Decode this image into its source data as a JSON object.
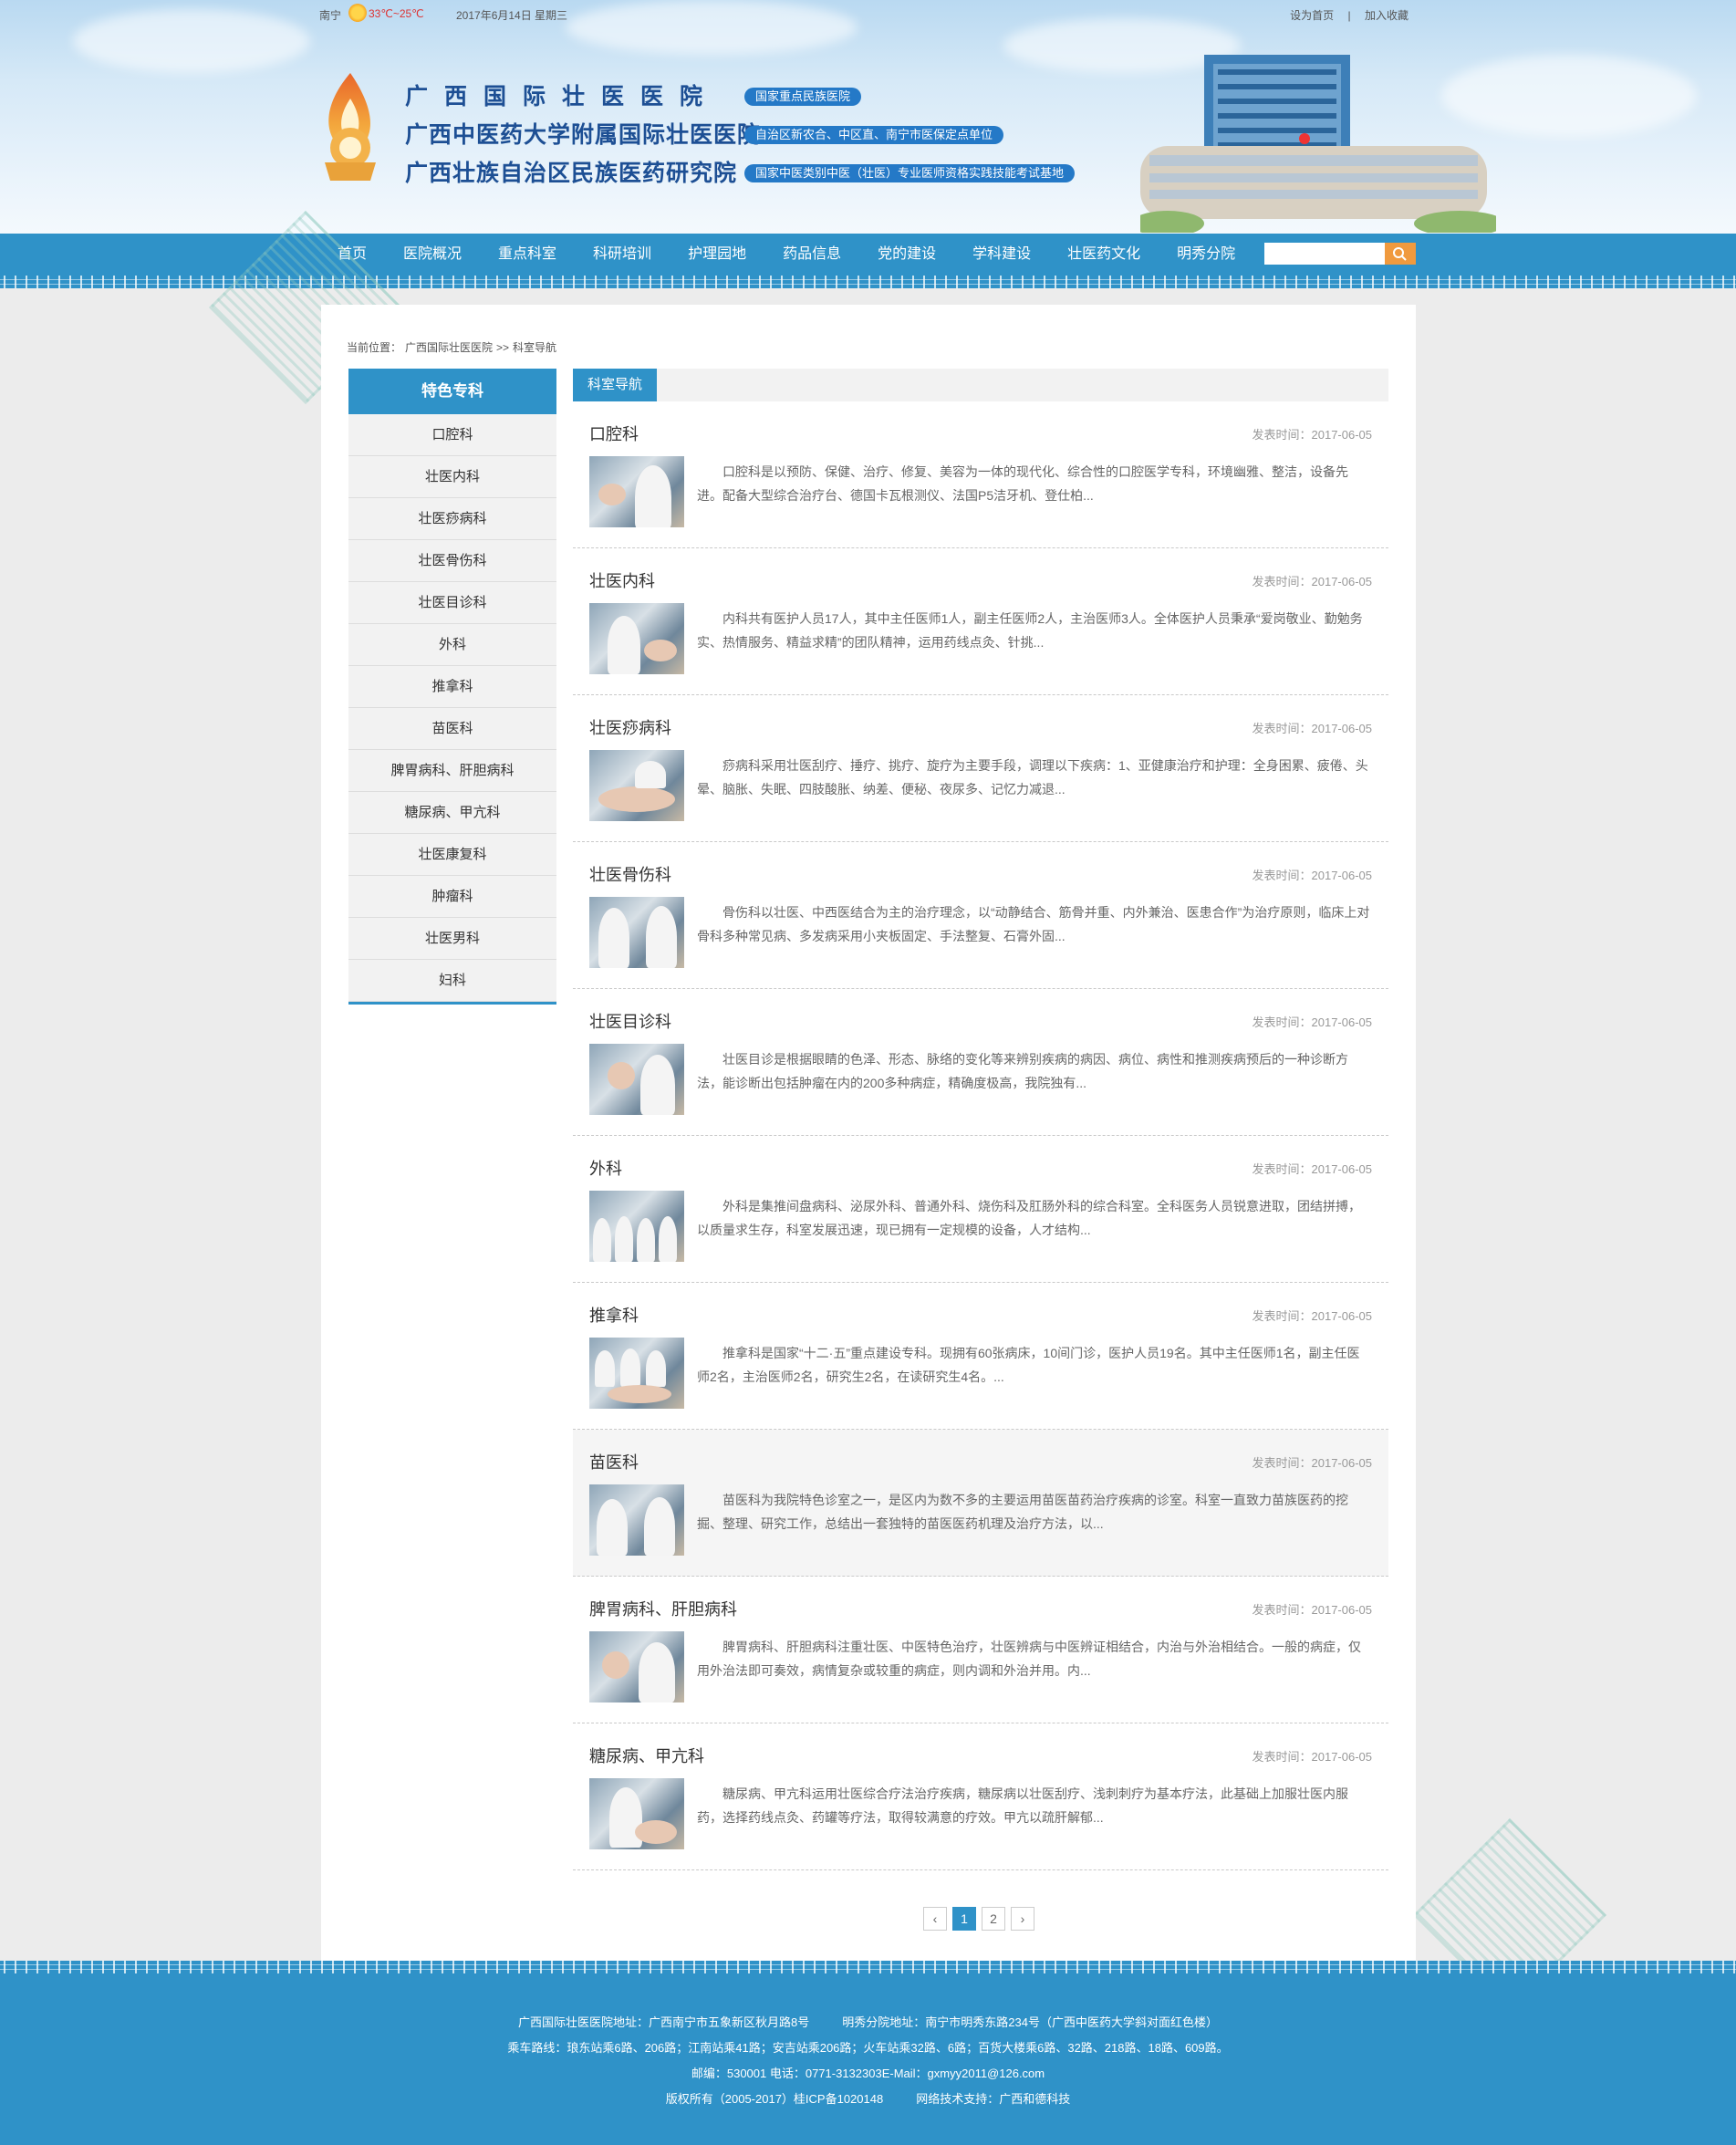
{
  "topbar": {
    "city": "南宁",
    "temperature": "33℃~25℃",
    "date": "2017年6月14日 星期三",
    "set_home": "设为首页",
    "separator": "|",
    "add_favorite": "加入收藏",
    "weather_icon": "sunny-cloudy-icon"
  },
  "header": {
    "names": [
      {
        "name": "广西国际壮医医院",
        "tag": "国家重点民族医院"
      },
      {
        "name": "广西中医药大学附属国际壮医医院",
        "tag": "自治区新农合、中区直、南宁市医保定点单位"
      },
      {
        "name": "广西壮族自治区民族医药研究院",
        "tag": "国家中医类别中医（壮医）专业医师资格实践技能考试基地"
      }
    ]
  },
  "nav": {
    "items": [
      "首页",
      "医院概况",
      "重点科室",
      "科研培训",
      "护理园地",
      "药品信息",
      "党的建设",
      "学科建设",
      "壮医药文化",
      "明秀分院"
    ],
    "search_placeholder": ""
  },
  "breadcrumb": {
    "label": "当前位置：",
    "home": "广西国际壮医医院",
    "sep": ">>",
    "current": "科室导航"
  },
  "sidebar": {
    "title": "特色专科",
    "items": [
      "口腔科",
      "壮医内科",
      "壮医痧病科",
      "壮医骨伤科",
      "壮医目诊科",
      "外科",
      "推拿科",
      "苗医科",
      "脾胃病科、肝胆病科",
      "糖尿病、甲亢科",
      "壮医康复科",
      "肿瘤科",
      "壮医男科",
      "妇科"
    ]
  },
  "content": {
    "section_title": "科室导航",
    "date_label": "发表时间：",
    "entries": [
      {
        "title": "口腔科",
        "date": "2017-06-05",
        "excerpt": "口腔科是以预防、保健、治疗、修复、美容为一体的现代化、综合性的口腔医学专科，环境幽雅、整洁，设备先进。配备大型综合治疗台、德国卡瓦根测仪、法国P5洁牙机、登仕柏..."
      },
      {
        "title": "壮医内科",
        "date": "2017-06-05",
        "excerpt": "内科共有医护人员17人，其中主任医师1人，副主任医师2人，主治医师3人。全体医护人员秉承“爱岗敬业、勤勉务实、热情服务、精益求精”的团队精神，运用药线点灸、针挑..."
      },
      {
        "title": "壮医痧病科",
        "date": "2017-06-05",
        "excerpt": "痧病科采用壮医刮疗、捶疗、挑疗、旋疗为主要手段，调理以下疾病：1、亚健康治疗和护理：全身困累、疲倦、头晕、脑胀、失眠、四肢酸胀、纳差、便秘、夜尿多、记忆力减退..."
      },
      {
        "title": "壮医骨伤科",
        "date": "2017-06-05",
        "excerpt": "骨伤科以壮医、中西医结合为主的治疗理念，以“动静结合、筋骨并重、内外兼治、医患合作”为治疗原则，临床上对骨科多种常见病、多发病采用小夹板固定、手法整复、石膏外固..."
      },
      {
        "title": "壮医目诊科",
        "date": "2017-06-05",
        "excerpt": "壮医目诊是根据眼睛的色泽、形态、脉络的变化等来辨别疾病的病因、病位、病性和推测疾病预后的一种诊断方法，能诊断出包括肿瘤在内的200多种病症，精确度极高，我院独有..."
      },
      {
        "title": "外科",
        "date": "2017-06-05",
        "excerpt": "外科是集推间盘病科、泌尿外科、普通外科、烧伤科及肛肠外科的综合科室。全科医务人员锐意进取，团结拼搏，以质量求生存，科室发展迅速，现已拥有一定规模的设备，人才结构..."
      },
      {
        "title": "推拿科",
        "date": "2017-06-05",
        "excerpt": "推拿科是国家“十二·五”重点建设专科。现拥有60张病床，10间门诊，医护人员19名。其中主任医师1名，副主任医师2名，主治医师2名，研究生2名，在读研究生4名。..."
      },
      {
        "title": "苗医科",
        "date": "2017-06-05",
        "excerpt": "苗医科为我院特色诊室之一，是区内为数不多的主要运用苗医苗药治疗疾病的诊室。科室一直致力苗族医药的挖掘、整理、研究工作，总结出一套独特的苗医医药机理及治疗方法，以..."
      },
      {
        "title": "脾胃病科、肝胆病科",
        "date": "2017-06-05",
        "excerpt": "脾胃病科、肝胆病科注重壮医、中医特色治疗，壮医辨病与中医辨证相结合，内治与外治相结合。一般的病症，仅用外治法即可奏效，病情复杂或较重的病症，则内调和外治并用。内..."
      },
      {
        "title": "糖尿病、甲亢科",
        "date": "2017-06-05",
        "excerpt": "糖尿病、甲亢科运用壮医综合疗法治疗疾病，糖尿病以壮医刮疗、浅刺刺疗为基本疗法，此基础上加服壮医内服药，选择药线点灸、药罐等疗法，取得较满意的疗效。甲亢以疏肝解郁..."
      }
    ]
  },
  "pager": {
    "prev": "‹",
    "pages": [
      "1",
      "2"
    ],
    "next": "›"
  },
  "footer": {
    "line1a": "广西国际壮医医院地址：广西南宁市五象新区秋月路8号",
    "line1b": "明秀分院地址：南宁市明秀东路234号（广西中医药大学斜对面红色楼）",
    "line2": "乘车路线：琅东站乘6路、206路；江南站乘41路；安吉站乘206路；火车站乘32路、6路；百货大楼乘6路、32路、218路、18路、609路。",
    "line3": "邮编：530001 电话：0771-3132303E-Mail：gxmyy2011@126.com",
    "line4a": "版权所有（2005-2017）桂ICP备1020148",
    "line4b": "网络技术支持：广西和德科技"
  },
  "colors": {
    "primary": "#2f92c8",
    "accent": "#f09a3e",
    "title_blue": "#1d4f94",
    "tag_blue": "#2479c7"
  }
}
